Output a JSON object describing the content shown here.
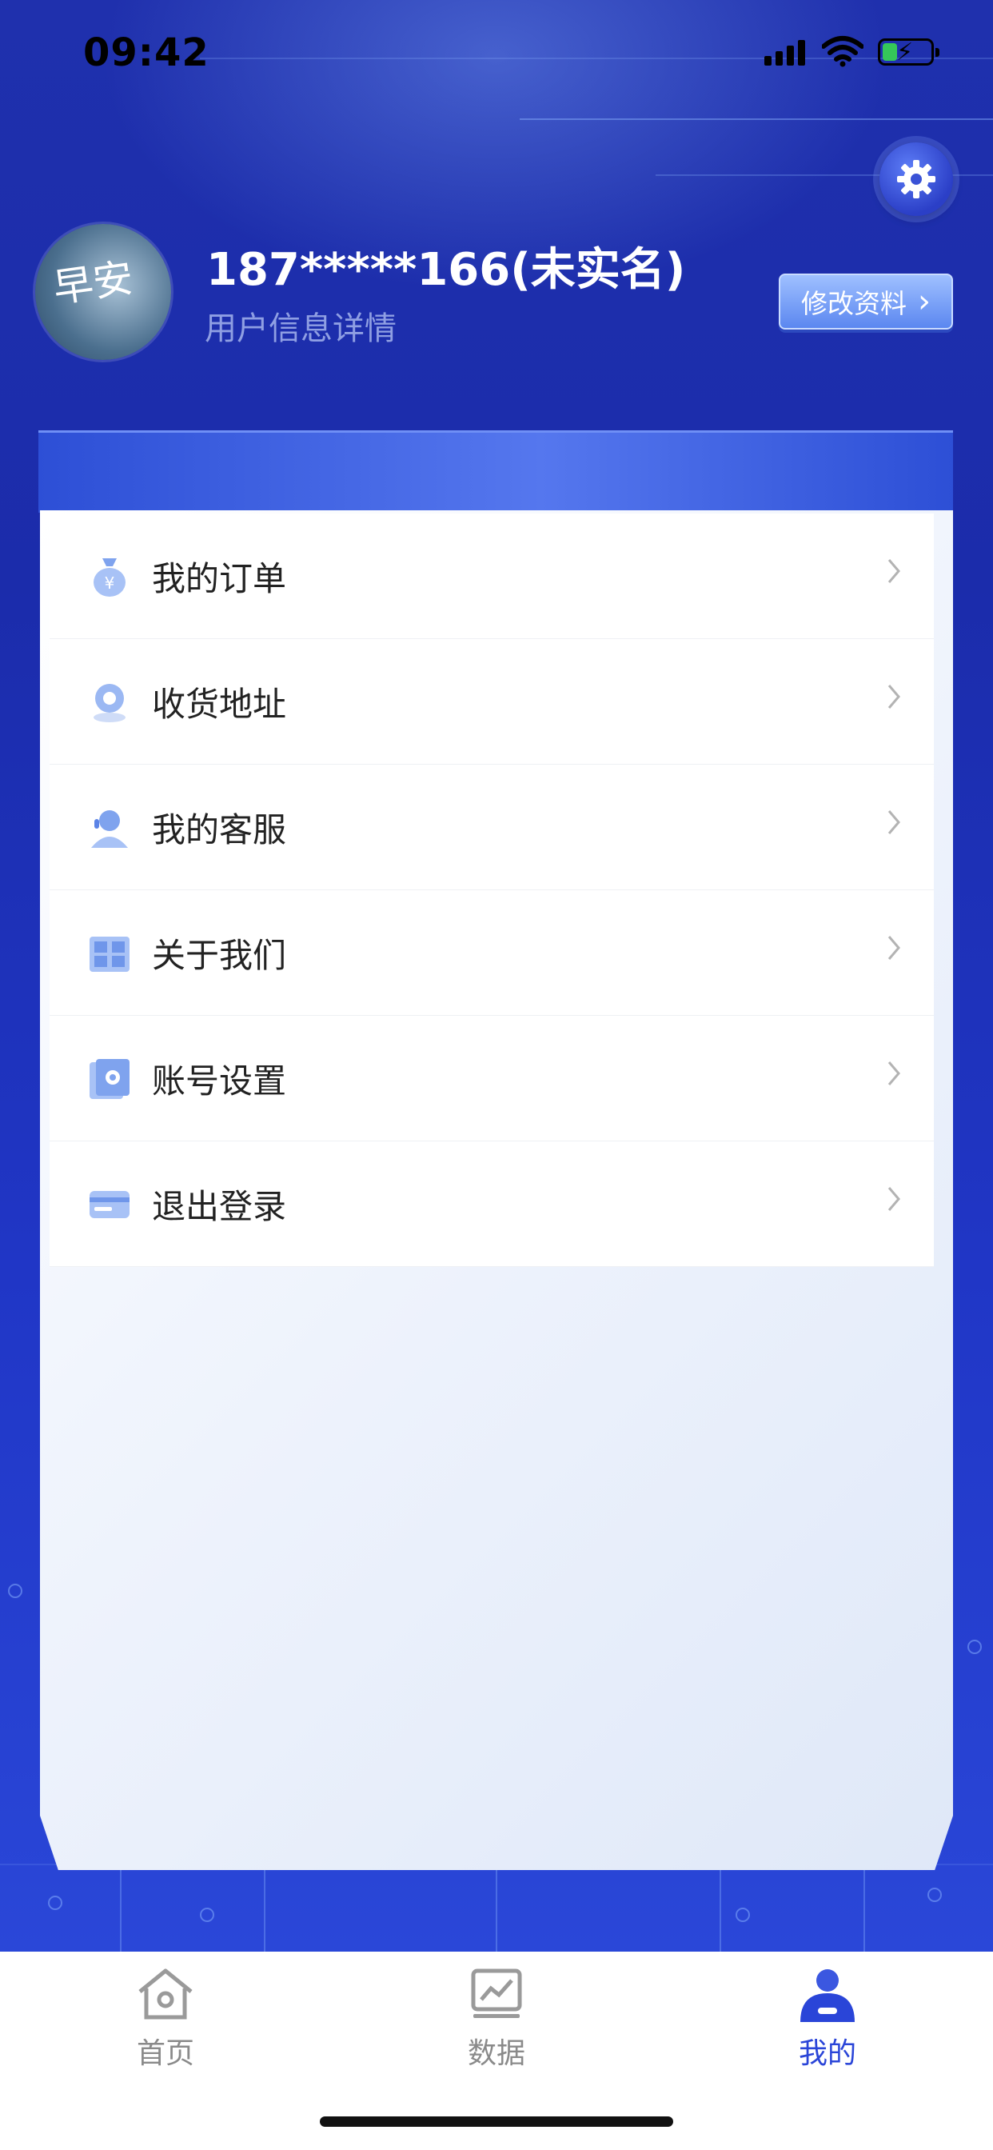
{
  "status_bar": {
    "time": "09:42"
  },
  "profile": {
    "avatar_text": "早安",
    "username": "187*****166(未实名)",
    "subtitle": "用户信息详情",
    "edit_button": "修改资料",
    "edit_chevron": "›"
  },
  "menu": {
    "items": [
      {
        "label": "我的订单",
        "icon": "money-bag-icon"
      },
      {
        "label": "收货地址",
        "icon": "location-pin-icon"
      },
      {
        "label": "我的客服",
        "icon": "customer-service-icon"
      },
      {
        "label": "关于我们",
        "icon": "building-icon"
      },
      {
        "label": "账号设置",
        "icon": "settings-doc-icon"
      },
      {
        "label": "退出登录",
        "icon": "logout-card-icon"
      }
    ]
  },
  "tabbar": {
    "tabs": [
      {
        "label": "首页",
        "icon": "home-icon",
        "active": false
      },
      {
        "label": "数据",
        "icon": "chart-icon",
        "active": false
      },
      {
        "label": "我的",
        "icon": "user-icon",
        "active": true
      }
    ]
  },
  "colors": {
    "accent": "#2a45d8",
    "background": "#1f30ad"
  }
}
